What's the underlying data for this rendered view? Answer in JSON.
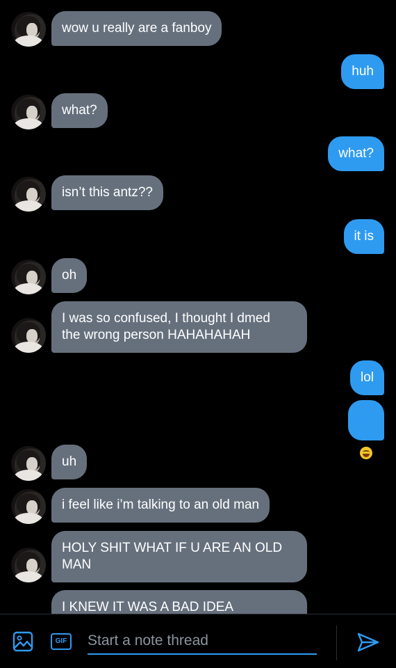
{
  "colors": {
    "background": "#000000",
    "incoming_bubble": "#66707d",
    "outgoing_bubble": "#2f9bf0",
    "accent": "#2f9bf0",
    "placeholder": "#8b949e"
  },
  "messages": [
    {
      "side": "in",
      "text": "wow u really are a fanboy",
      "avatar": true
    },
    {
      "side": "out",
      "text": "huh"
    },
    {
      "side": "in",
      "text": "what?",
      "avatar": true
    },
    {
      "side": "out",
      "text": "what?"
    },
    {
      "side": "in",
      "text": "isn’t this antz??",
      "avatar": true
    },
    {
      "side": "out",
      "text": "it is"
    },
    {
      "side": "in",
      "text": "oh",
      "avatar": true
    },
    {
      "side": "in",
      "text": "I was so confused, I thought I dmed\nthe wrong person HAHAHAHAH",
      "avatar": true
    },
    {
      "side": "out",
      "text": "lol"
    },
    {
      "side": "out",
      "text": "",
      "emoji": "face-with-tears-of-joy-emoji"
    },
    {
      "side": "in",
      "text": "uh",
      "avatar": true
    },
    {
      "side": "in",
      "text": "i feel like i’m talking to an old man",
      "avatar": true
    },
    {
      "side": "in",
      "text": "HOLY SHIT WHAT IF U ARE AN OLD\nMAN",
      "avatar": true
    },
    {
      "side": "in",
      "text": "I KNEW IT WAS A BAD IDEA",
      "avatar": false
    }
  ],
  "composer": {
    "image_icon": "image-icon",
    "gif_label": "GIF",
    "placeholder": "Start a note thread",
    "value": "",
    "send_icon": "send-icon"
  }
}
